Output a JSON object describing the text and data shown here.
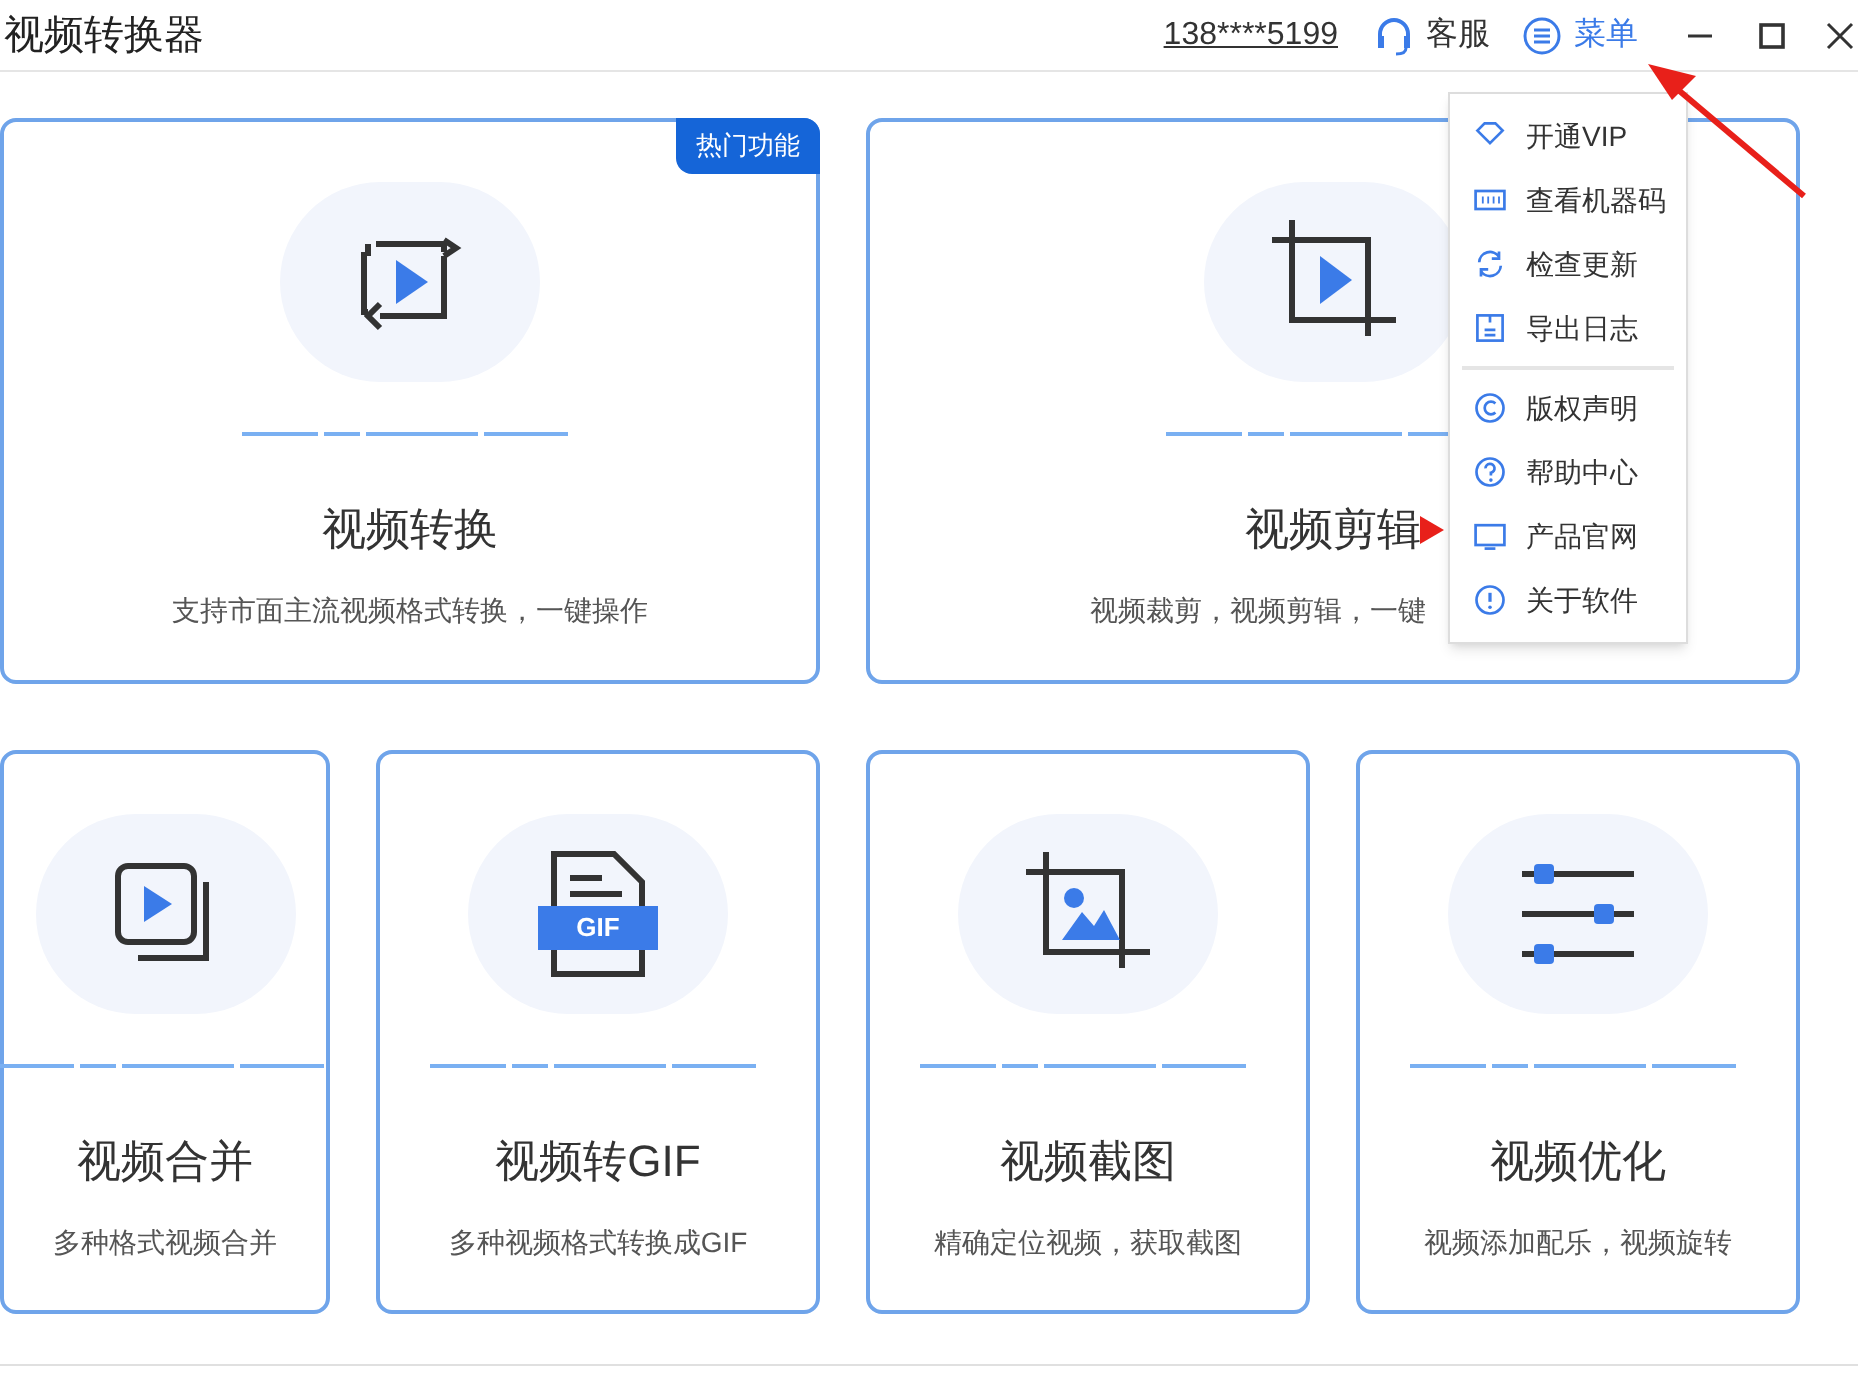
{
  "window": {
    "title": "视频转换器"
  },
  "header": {
    "account": "138****5199",
    "support": "客服",
    "menu": {
      "label": "菜单",
      "expanded": true
    }
  },
  "top_cards": [
    {
      "kind": "convert",
      "title": "视频转换",
      "description": "支持市面主流视频格式转换，一键操作",
      "badge": "热门功能"
    },
    {
      "kind": "crop",
      "title": "视频剪辑",
      "description": "视频裁剪，视频剪辑，一键"
    }
  ],
  "bottom_cards": [
    {
      "kind": "merge",
      "title": "视频合并",
      "description": "多种格式视频合并"
    },
    {
      "kind": "gif",
      "title": "视频转GIF",
      "description": "多种视频格式转换成GIF",
      "icon_label": "GIF"
    },
    {
      "kind": "screenshot",
      "title": "视频截图",
      "description": "精确定位视频，获取截图"
    },
    {
      "kind": "sliders",
      "title": "视频优化",
      "description": "视频添加配乐，视频旋转"
    }
  ],
  "menu_items": [
    {
      "kind": "vip",
      "label": "开通VIP"
    },
    {
      "kind": "code",
      "label": "查看机器码"
    },
    {
      "kind": "update",
      "label": "检查更新"
    },
    {
      "kind": "log",
      "label": "导出日志",
      "divider_after": true
    },
    {
      "kind": "copyright",
      "label": "版权声明"
    },
    {
      "kind": "help",
      "label": "帮助中心"
    },
    {
      "kind": "website",
      "label": "产品官网"
    },
    {
      "kind": "about",
      "label": "关于软件"
    }
  ]
}
